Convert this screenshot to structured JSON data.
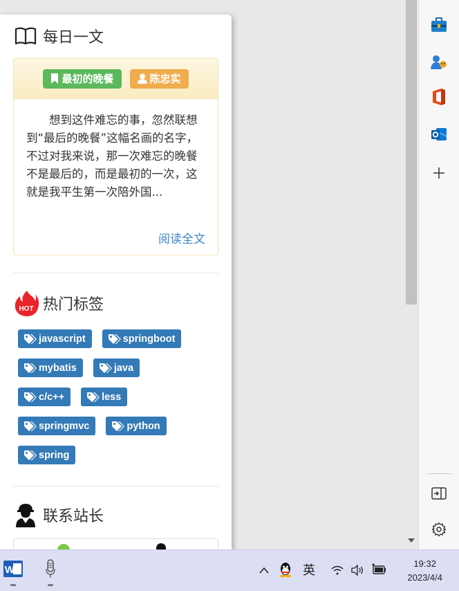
{
  "daily": {
    "title": "每日一文",
    "article_title": "最初的晚餐",
    "author": "陈忠实",
    "excerpt": "想到这件难忘的事，忽然联想到“最后的晚餐”这幅名画的名字，不过对我来说，那一次难忘的晚餐不是最后的，而是最初的一次，这就是我平生第一次陪外国...",
    "read_more": "阅读全文"
  },
  "hot_tags": {
    "title": "热门标签",
    "hot_badge": "HOT",
    "rows": [
      [
        "javascript",
        "springboot"
      ],
      [
        "mybatis",
        "java"
      ],
      [
        "c/c++",
        "less"
      ],
      [
        "springmvc",
        "python"
      ],
      [
        "spring"
      ]
    ]
  },
  "contact": {
    "title": "联系站长"
  },
  "taskbar": {
    "ime_label": "英",
    "time": "19:32",
    "date": "2023/4/4"
  },
  "colors": {
    "tag_blue": "#337ab7",
    "badge_green": "#5cb85c",
    "badge_orange": "#f0ad4e",
    "link_blue": "#3a87c8",
    "taskbar_bg": "#dcdff4"
  }
}
